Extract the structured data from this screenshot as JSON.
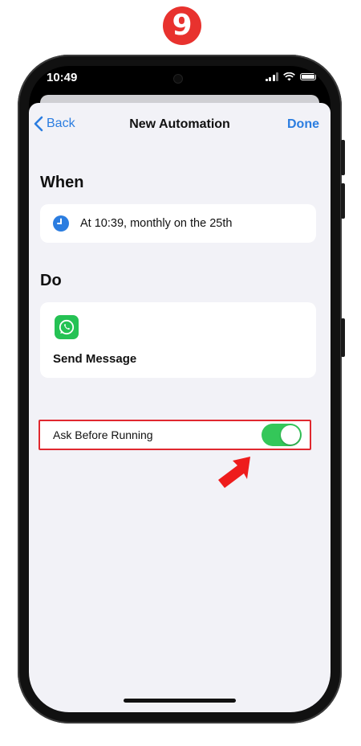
{
  "step_badge": "9",
  "status_bar": {
    "time": "10:49"
  },
  "nav": {
    "back_label": "Back",
    "title": "New Automation",
    "done_label": "Done"
  },
  "when": {
    "heading": "When",
    "trigger_icon": "clock-icon",
    "trigger_text": "At 10:39, monthly on the 25th"
  },
  "do": {
    "heading": "Do",
    "action_icon": "whatsapp-icon",
    "action_label": "Send Message"
  },
  "ask_before_running": {
    "label": "Ask Before Running",
    "enabled": true
  },
  "colors": {
    "accent": "#2b7de0",
    "toggle_on": "#34c759",
    "highlight": "#e0282f",
    "whatsapp": "#25c254"
  }
}
